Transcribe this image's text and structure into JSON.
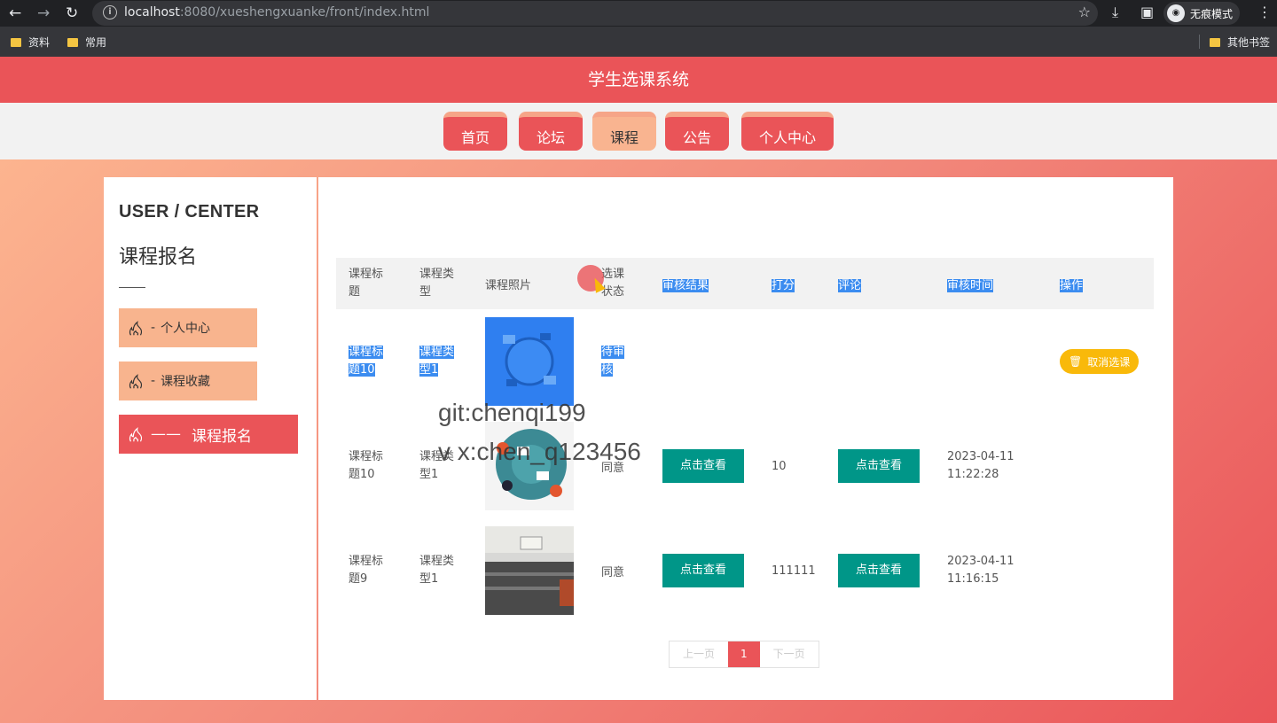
{
  "browser": {
    "url_host": "localhost",
    "url_rest": ":8080/xueshengxuanke/front/index.html",
    "incognito_label": "无痕模式",
    "bookmarks": [
      "资料",
      "常用"
    ],
    "other_bookmarks": "其他书签"
  },
  "site": {
    "title": "学生选课系统",
    "nav": [
      "首页",
      "论坛",
      "课程",
      "公告",
      "个人中心"
    ],
    "active_nav": "课程"
  },
  "sidebar": {
    "title": "USER / CENTER",
    "subtitle": "课程报名",
    "items": [
      {
        "label": "个人中心",
        "prefix": "-"
      },
      {
        "label": "课程收藏",
        "prefix": "-"
      },
      {
        "label": "课程报名",
        "prefix": "——"
      }
    ]
  },
  "table": {
    "headers": [
      "课程标题",
      "课程类型",
      "课程照片",
      "选课状态",
      "审核结果",
      "打分",
      "评论",
      "审核时间",
      "操作"
    ],
    "rows": [
      {
        "title": "课程标题10",
        "type": "课程类型1",
        "status": "待审核",
        "action": "取消选课"
      },
      {
        "title": "课程标题10",
        "type": "课程类型1",
        "status": "同意",
        "result": "点击查看",
        "score": "10",
        "comment": "点击查看",
        "time": "2023-04-11 11:22:28"
      },
      {
        "title": "课程标题9",
        "type": "课程类型1",
        "status": "同意",
        "result": "点击查看",
        "score": "111111",
        "comment": "点击查看",
        "time": "2023-04-11 11:16:15"
      }
    ]
  },
  "pager": {
    "prev": "上一页",
    "current": "1",
    "next": "下一页"
  },
  "watermark": [
    "git:chenqi199",
    "v x:chen_q123456"
  ],
  "colors": {
    "accent": "#ea5458",
    "teal": "#009688",
    "amber": "#f9b90a",
    "peach": "#f8b48e"
  }
}
